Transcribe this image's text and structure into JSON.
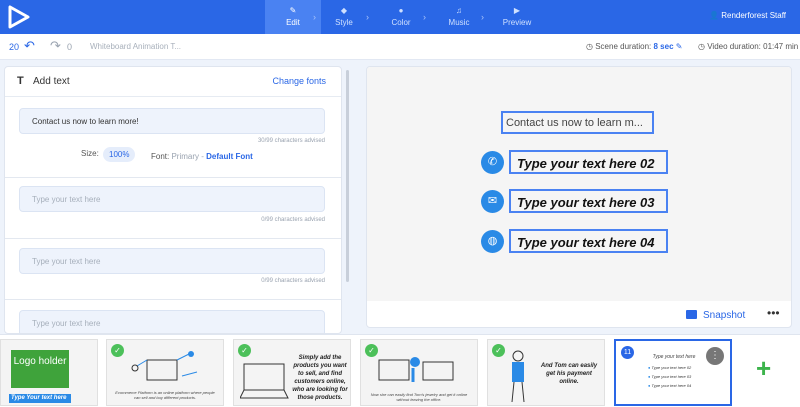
{
  "nav": {
    "steps": [
      {
        "label": "Edit",
        "icon": "pencil-icon",
        "active": true
      },
      {
        "label": "Style",
        "icon": "style-icon",
        "active": false
      },
      {
        "label": "Color",
        "icon": "palette-icon",
        "active": false
      },
      {
        "label": "Music",
        "icon": "music-icon",
        "active": false
      },
      {
        "label": "Preview",
        "icon": "play-icon",
        "active": false
      }
    ],
    "user": "Renderforest Staff"
  },
  "toolbar": {
    "undo_count": "20",
    "redo_count": "0",
    "project_name": "Whiteboard Animation T...",
    "scene_duration_label": "Scene duration:",
    "scene_duration_value": "8 sec",
    "video_duration": "Video duration: 01:47 min"
  },
  "panel": {
    "title": "Add text",
    "change_fonts": "Change fonts",
    "fields": [
      {
        "value": "Contact us now to learn more!",
        "counter": "30/99 characters advised"
      },
      {
        "placeholder": "Type your text here",
        "counter": "0/99 characters advised"
      },
      {
        "placeholder": "Type your text here",
        "counter": "0/99 characters advised"
      },
      {
        "placeholder": "Type your text here"
      }
    ],
    "size_label": "Size:",
    "size_value": "100%",
    "font_label": "Font:",
    "font_primary": "Primary -",
    "font_default": "Default Font"
  },
  "preview": {
    "contact_text": "Contact us now to learn m...",
    "rows": [
      {
        "icon": "phone-icon",
        "text": "Type your text here 02"
      },
      {
        "icon": "mail-icon",
        "text": "Type your text here 03"
      },
      {
        "icon": "globe-icon",
        "text": "Type your text here 04"
      }
    ],
    "snapshot_label": "Snapshot"
  },
  "filmstrip": {
    "logo_holder": "Logo holder",
    "logo_tagline": "Type Your text here",
    "scene2_caption": "Ecommerce Platform is an online platform where people can sell and buy different products.",
    "scene3_text": "Simply add the products you want to sell, and find customers online, who are looking for those products.",
    "scene4_caption": "Now she can easily find Tom's jewelry and get it online without leaving the office.",
    "scene5_text": "And Tom can easily get his payment online.",
    "active_scene_number": "11",
    "active_title": "Type your text here",
    "active_rows": [
      "Type your text here 02",
      "Type your text here 03",
      "Type your text here 04"
    ],
    "add_icon": "plus-icon"
  },
  "colors": {
    "accent": "#2a67e6",
    "check": "#4cc05a",
    "add": "#3cb44b"
  }
}
